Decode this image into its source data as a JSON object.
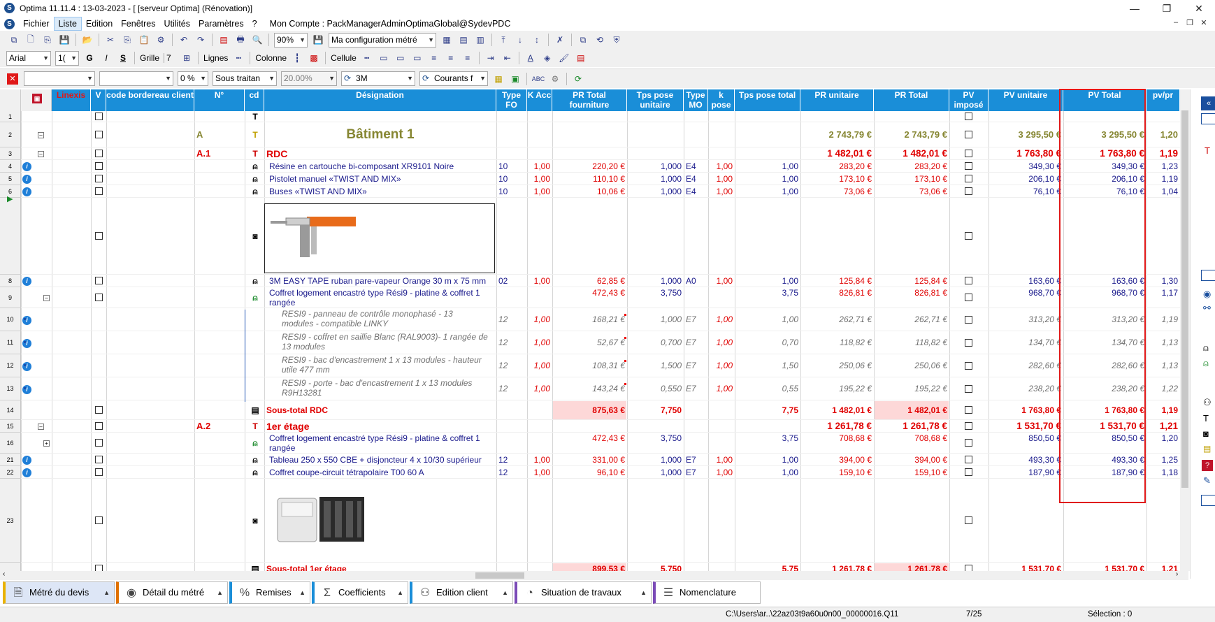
{
  "window": {
    "title": "Optima 11.11.4 : 13-03-2023 - [ [serveur Optima] (Rénovation)]",
    "minimize": "—",
    "maximize": "❐",
    "close": "✕"
  },
  "menu": {
    "items": [
      "Fichier",
      "Liste",
      "Edition",
      "Fenêtres",
      "Utilités",
      "Paramètres",
      "?"
    ],
    "account": "Mon Compte : PackManagerAdminOptimaGlobal@SydevPDC"
  },
  "toolbar1": {
    "zoom": "90%",
    "config": "Ma configuration métré"
  },
  "toolbar2": {
    "font": "Arial",
    "size": "1(",
    "bold": "G",
    "italic": "I",
    "strike": "S",
    "grille_label": "Grille",
    "grille_value": "7",
    "lignes_label": "Lignes",
    "colonne_label": "Colonne",
    "cellule_label": "Cellule"
  },
  "toolbar3": {
    "pct": "0 %",
    "sous_traitan": "Sous traitan",
    "rate": "20.00%",
    "brand": "3M",
    "courants": "Courants f"
  },
  "columns": [
    {
      "label": "Linexis"
    },
    {
      "label": "V"
    },
    {
      "label": "code bordereau client"
    },
    {
      "label": "N°"
    },
    {
      "label": "cd"
    },
    {
      "label": "Désignation"
    },
    {
      "label": "Type FO"
    },
    {
      "label": "K Acc"
    },
    {
      "label": "PR Total fourniture"
    },
    {
      "label": "Tps pose unitaire"
    },
    {
      "label": "Type MO"
    },
    {
      "label": "k pose"
    },
    {
      "label": "Tps pose total"
    },
    {
      "label": "PR unitaire"
    },
    {
      "label": "PR Total"
    },
    {
      "label": "PV imposé"
    },
    {
      "label": "PV unitaire"
    },
    {
      "label": "PV Total"
    },
    {
      "label": "pv/pr"
    }
  ],
  "rows": [
    {
      "num": "1"
    },
    {
      "num": "2",
      "n": "A",
      "des": "Bâtiment 1",
      "pru": "2 743,79 €",
      "prt": "2 743,79 €",
      "pvu": "3 295,50 €",
      "pvt": "3 295,50 €",
      "ratio": "1,20"
    },
    {
      "num": "3",
      "n": "A.1",
      "des": "RDC",
      "pru": "1 482,01 €",
      "prt": "1 482,01 €",
      "pvu": "1 763,80 €",
      "pvt": "1 763,80 €",
      "ratio": "1,19"
    },
    {
      "num": "4",
      "des": "Résine en cartouche bi-composant XR9101 Noire",
      "tfo": "10",
      "kacc": "1,00",
      "prf": "220,20 €",
      "tpu": "1,000",
      "tmo": "E4",
      "kp": "1,00",
      "tpt": "1,00",
      "pru": "283,20 €",
      "prt": "283,20 €",
      "pvu": "349,30 €",
      "pvt": "349,30 €",
      "ratio": "1,23"
    },
    {
      "num": "5",
      "des": "Pistolet manuel «TWIST AND MIX»",
      "tfo": "10",
      "kacc": "1,00",
      "prf": "110,10 €",
      "tpu": "1,000",
      "tmo": "E4",
      "kp": "1,00",
      "tpt": "1,00",
      "pru": "173,10 €",
      "prt": "173,10 €",
      "pvu": "206,10 €",
      "pvt": "206,10 €",
      "ratio": "1,19"
    },
    {
      "num": "6",
      "des": "Buses «TWIST AND MIX»",
      "tfo": "10",
      "kacc": "1,00",
      "prf": "10,06 €",
      "tpu": "1,000",
      "tmo": "E4",
      "kp": "1,00",
      "tpt": "1,00",
      "pru": "73,06 €",
      "prt": "73,06 €",
      "pvu": "76,10 €",
      "pvt": "76,10 €",
      "ratio": "1,04"
    },
    {
      "num": ""
    },
    {
      "num": "8",
      "des": "3M EASY TAPE ruban pare-vapeur Orange 30 m x 75 mm",
      "tfo": "02",
      "kacc": "1,00",
      "prf": "62,85 €",
      "tpu": "1,000",
      "tmo": "A0",
      "kp": "1,00",
      "tpt": "1,00",
      "pru": "125,84 €",
      "prt": "125,84 €",
      "pvu": "163,60 €",
      "pvt": "163,60 €",
      "ratio": "1,30"
    },
    {
      "num": "9",
      "des1": "Coffret logement encastré type Rési9 - platine & coffret 1",
      "des2": "rangée",
      "prf": "472,43 €",
      "tpu": "3,750",
      "tpt": "3,75",
      "pru": "826,81 €",
      "prt": "826,81 €",
      "pvu": "968,70 €",
      "pvt": "968,70 €",
      "ratio": "1,17"
    },
    {
      "num": "10",
      "des1": "RESI9 - panneau de contrôle monophasé - 13",
      "des2": "modules - compatible LINKY",
      "tfo": "12",
      "kacc": "1,00",
      "prf": "168,21 €",
      "tpu": "1,000",
      "tmo": "E7",
      "kp": "1,00",
      "tpt": "1,00",
      "pru": "262,71 €",
      "prt": "262,71 €",
      "pvu": "313,20 €",
      "pvt": "313,20 €",
      "ratio": "1,19"
    },
    {
      "num": "11",
      "des1": "RESI9 - coffret en saillie Blanc (RAL9003)- 1 rangée de",
      "des2": "13 modules",
      "tfo": "12",
      "kacc": "1,00",
      "prf": "52,67 €",
      "tpu": "0,700",
      "tmo": "E7",
      "kp": "1,00",
      "tpt": "0,70",
      "pru": "118,82 €",
      "prt": "118,82 €",
      "pvu": "134,70 €",
      "pvt": "134,70 €",
      "ratio": "1,13"
    },
    {
      "num": "12",
      "des1": "RESI9 - bac d'encastrement 1 x 13 modules - hauteur",
      "des2": "utile 477 mm",
      "tfo": "12",
      "kacc": "1,00",
      "prf": "108,31 €",
      "tpu": "1,500",
      "tmo": "E7",
      "kp": "1,00",
      "tpt": "1,50",
      "pru": "250,06 €",
      "prt": "250,06 €",
      "pvu": "282,60 €",
      "pvt": "282,60 €",
      "ratio": "1,13"
    },
    {
      "num": "13",
      "des1": "RESI9 - porte - bac d'encastrement 1 x 13 modules",
      "des2": "R9H13281",
      "tfo": "12",
      "kacc": "1,00",
      "prf": "143,24 €",
      "tpu": "0,550",
      "tmo": "E7",
      "kp": "1,00",
      "tpt": "0,55",
      "pru": "195,22 €",
      "prt": "195,22 €",
      "pvu": "238,20 €",
      "pvt": "238,20 €",
      "ratio": "1,22"
    },
    {
      "num": "14",
      "des": "Sous-total RDC",
      "prf": "875,63 €",
      "tpu": "7,750",
      "tpt": "7,75",
      "pru": "1 482,01 €",
      "prt": "1 482,01 €",
      "pvu": "1 763,80 €",
      "pvt": "1 763,80 €",
      "ratio": "1,19"
    },
    {
      "num": "15",
      "n": "A.2",
      "des": "1er étage",
      "pru": "1 261,78 €",
      "prt": "1 261,78 €",
      "pvu": "1 531,70 €",
      "pvt": "1 531,70 €",
      "ratio": "1,21"
    },
    {
      "num": "16",
      "des1": "Coffret logement encastré type Rési9 - platine & coffret 1",
      "des2": "rangée",
      "prf": "472,43 €",
      "tpu": "3,750",
      "tpt": "3,75",
      "pru": "708,68 €",
      "prt": "708,68 €",
      "pvu": "850,50 €",
      "pvt": "850,50 €",
      "ratio": "1,20"
    },
    {
      "num": "21",
      "des": "Tableau 250 x 550 CBE + disjoncteur 4 x 10/30 supérieur",
      "tfo": "12",
      "kacc": "1,00",
      "prf": "331,00 €",
      "tpu": "1,000",
      "tmo": "E7",
      "kp": "1,00",
      "tpt": "1,00",
      "pru": "394,00 €",
      "prt": "394,00 €",
      "pvu": "493,30 €",
      "pvt": "493,30 €",
      "ratio": "1,25"
    },
    {
      "num": "22",
      "des": "Coffret coupe-circuit tétrapolaire T00 60 A",
      "tfo": "12",
      "kacc": "1,00",
      "prf": "96,10 €",
      "tpu": "1,000",
      "tmo": "E7",
      "kp": "1,00",
      "tpt": "1,00",
      "pru": "159,10 €",
      "prt": "159,10 €",
      "pvu": "187,90 €",
      "pvt": "187,90 €",
      "ratio": "1,18"
    },
    {
      "num": "23"
    },
    {
      "num": "",
      "des": "Sous-total 1er étage",
      "prf": "899,53 €",
      "tpu": "5,750",
      "tpt": "5,75",
      "pru": "1 261,78 €",
      "prt": "1 261,78 €",
      "pvu": "1 531,70 €",
      "pvt": "1 531,70 €",
      "ratio": "1,21"
    }
  ],
  "tabs": [
    {
      "label": "Métré du devis"
    },
    {
      "label": "Détail du métré"
    },
    {
      "label": "Remises"
    },
    {
      "label": "Coefficients"
    },
    {
      "label": "Edition client"
    },
    {
      "label": "Situation de travaux"
    },
    {
      "label": "Nomenclature"
    }
  ],
  "status": {
    "path": "C:\\Users\\ar..\\22az03t9a60u0n00_00000016.Q11",
    "position": "7/25",
    "selection": "Sélection : 0"
  },
  "colors": {
    "header": "#1a8ed8",
    "red": "#e00000",
    "blue": "#1a1a8c",
    "olive": "#868632",
    "pink": "#fdd8d8"
  }
}
